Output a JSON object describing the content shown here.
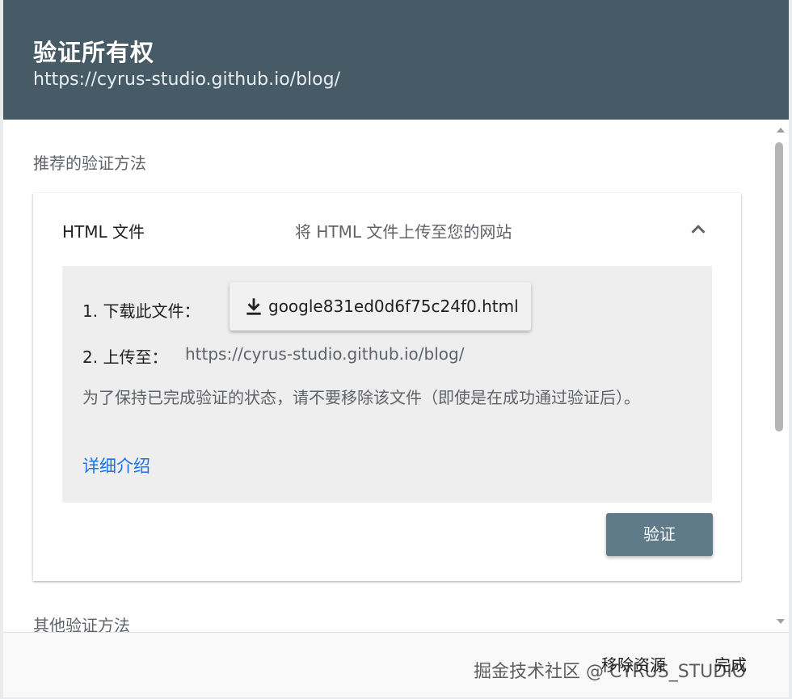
{
  "dialog": {
    "title": "验证所有权",
    "subtitle": "https://cyrus-studio.github.io/blog/"
  },
  "recommended": {
    "label": "推荐的验证方法",
    "method": {
      "title": "HTML 文件",
      "description": "将 HTML 文件上传至您的网站",
      "step1_label": "1. 下载此文件：",
      "download_filename": "google831ed0d6f75c24f0.html",
      "step2_label": "2. 上传至：",
      "step2_url": "https://cyrus-studio.github.io/blog/",
      "note": "为了保持已完成验证的状态，请不要移除该文件（即使是在成功通过验证后）。",
      "learn_more": "详细介绍",
      "verify_button": "验证"
    }
  },
  "other": {
    "label": "其他验证方法"
  },
  "footer": {
    "remove_button": "移除资源",
    "done_button": "完成"
  },
  "watermark": {
    "text": "掘金技术社区 @ CYRUS_STUDIO"
  },
  "icons": {
    "collapse": "chevron-up-icon",
    "download": "download-icon",
    "scroll_up": "arrow-up-icon",
    "scroll_down": "arrow-down-icon"
  },
  "colors": {
    "header_bg": "#475b66",
    "verify_button_bg": "#5f7b89",
    "link": "#1a73e8",
    "panel_bg": "#eeeeee"
  }
}
